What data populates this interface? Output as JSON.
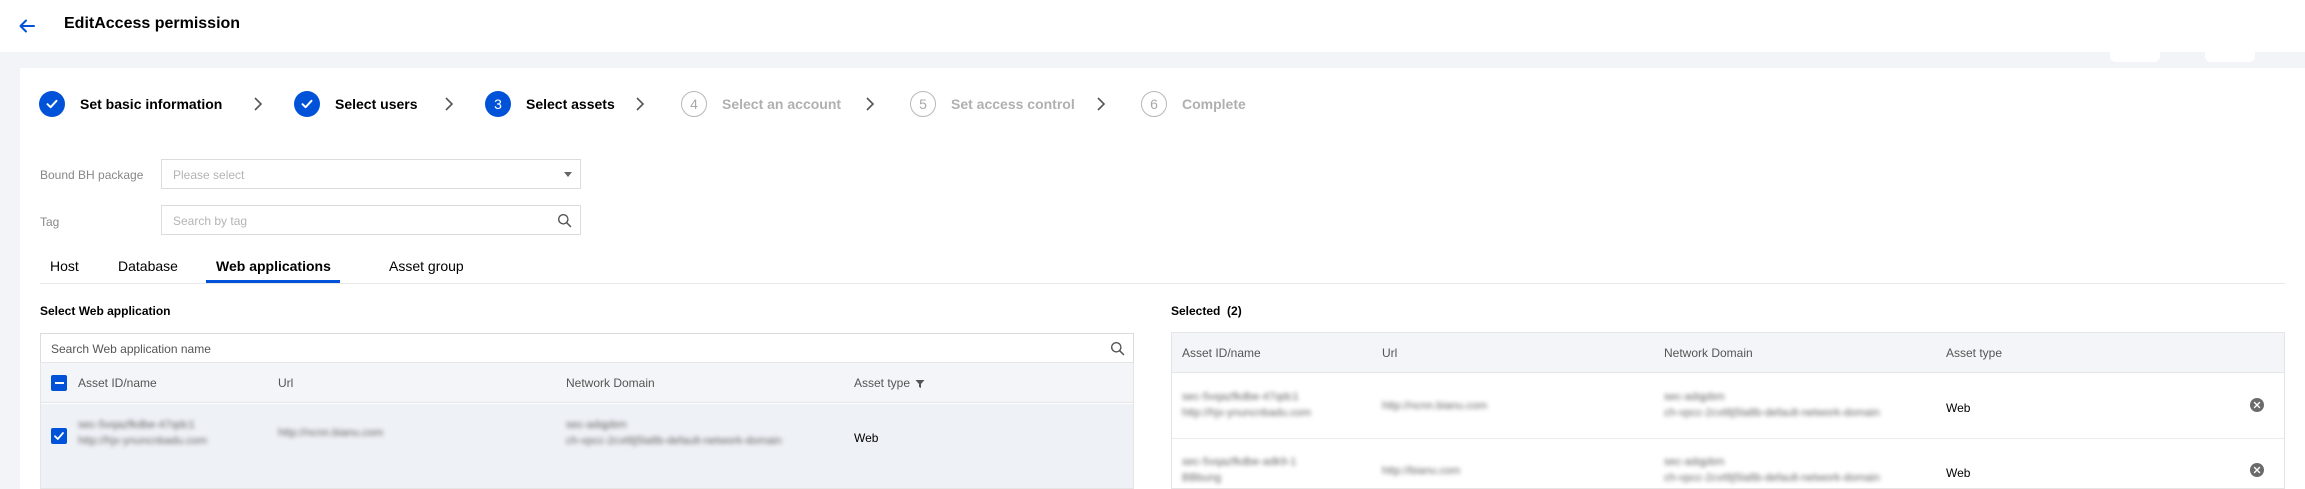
{
  "header": {
    "title": "EditAccess permission"
  },
  "steps": [
    {
      "label": "Set basic information",
      "state": "done",
      "number": ""
    },
    {
      "label": "Select users",
      "state": "done",
      "number": ""
    },
    {
      "label": "Select assets",
      "state": "current",
      "number": "3"
    },
    {
      "label": "Select an account",
      "state": "pending",
      "number": "4"
    },
    {
      "label": "Set access control",
      "state": "pending",
      "number": "5"
    },
    {
      "label": "Complete",
      "state": "pending",
      "number": "6"
    }
  ],
  "form": {
    "package_label": "Bound BH package",
    "package_placeholder": "Please select",
    "tag_label": "Tag",
    "tag_placeholder": "Search by tag"
  },
  "tabs": [
    "Host",
    "Database",
    "Web applications",
    "Asset group"
  ],
  "active_tab": "Web applications",
  "left": {
    "title": "Select Web application",
    "search_placeholder": "Search Web application name",
    "columns": [
      "Asset ID/name",
      "Url",
      "Network Domain",
      "Asset type"
    ],
    "rows": [
      {
        "id": "sec-5vqazfkdbe-47qdc1",
        "name": "http://hjx-ynuncnbadu.com",
        "url": "http://ncnn.bianu.com",
        "domain": "sec-adqpbm",
        "domain_sub": "ch-vpcc-2cvt8j5la8b-default-network-domain",
        "type": "Web"
      }
    ]
  },
  "right": {
    "title": "Selected",
    "count": "(2)",
    "columns": [
      "Asset ID/name",
      "Url",
      "Network Domain",
      "Asset type"
    ],
    "rows": [
      {
        "id": "sec-5vqazfkdbe-47qdc1",
        "name": "http://hjx-ynuncnbadu.com",
        "url": "http://ncnn.bianu.com",
        "domain": "sec-adqpbm",
        "domain_sub": "ch-vpcc-2cvt8j5la8b-default-network-domain",
        "type": "Web"
      },
      {
        "id": "sec-5vqazfkdbe-adk9-1",
        "name": "BBbung",
        "url": "http://bianu.com",
        "domain": "sec-adqpbm",
        "domain_sub": "ch-vpcc-2cvt8j5la8b-default-network-domain",
        "type": "Web"
      }
    ]
  },
  "colors": {
    "primary": "#0052d9",
    "pending": "#b0b0b0"
  }
}
